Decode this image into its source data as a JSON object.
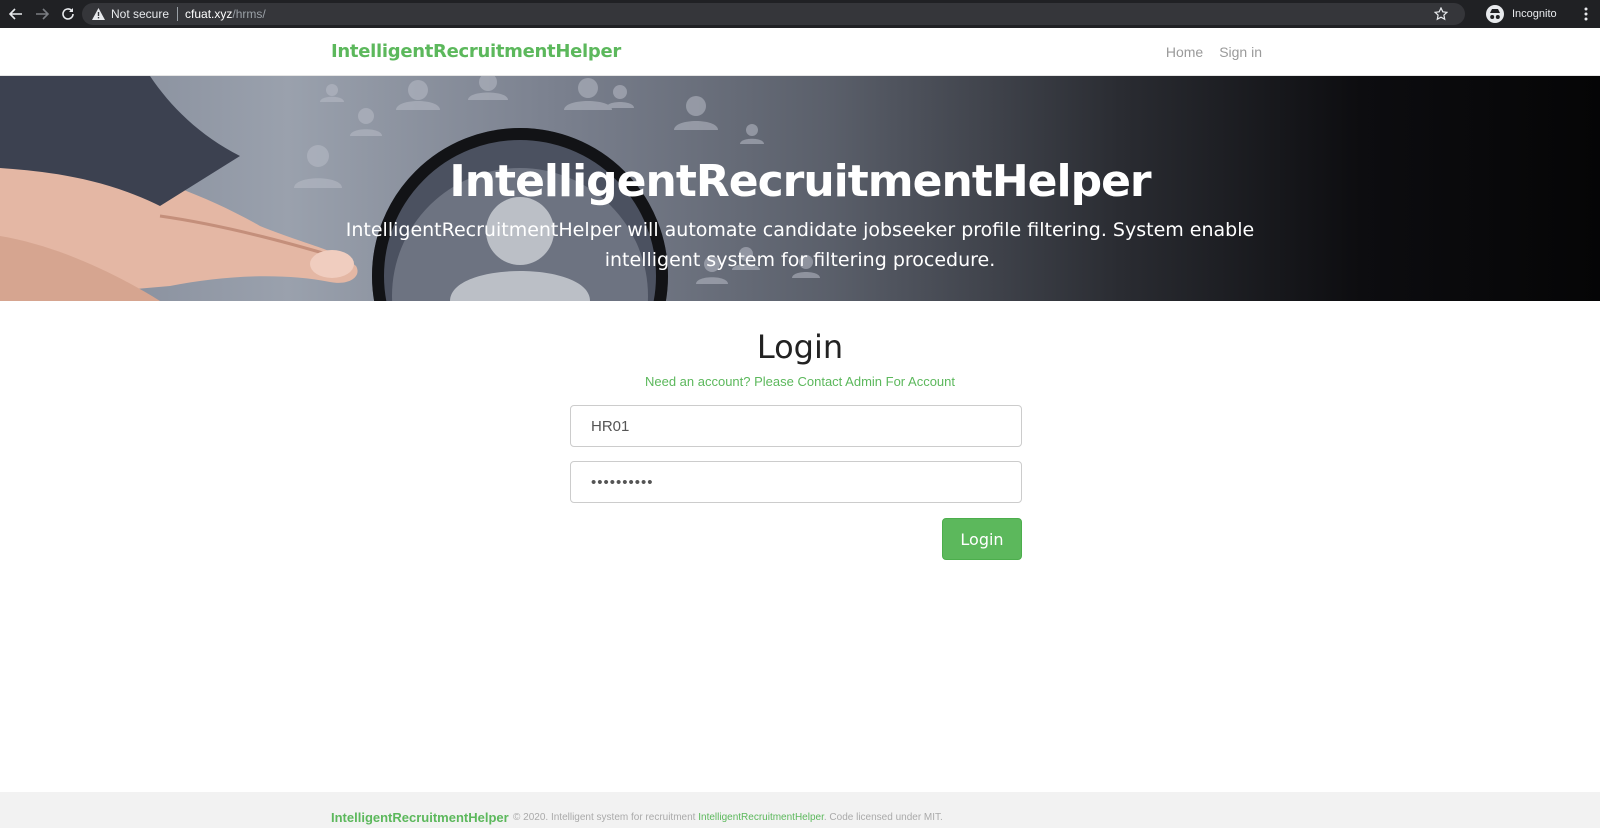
{
  "browser": {
    "security_label": "Not secure",
    "url_host": "cfuat.xyz",
    "url_path": "/hrms/",
    "profile_label": "Incognito"
  },
  "navbar": {
    "brand": "IntelligentRecruitmentHelper",
    "links": [
      "Home",
      "Sign in"
    ]
  },
  "hero": {
    "title": "IntelligentRecruitmentHelper",
    "subtitle": "IntelligentRecruitmentHelper will automate candidate jobseeker profile filtering. System enable intelligent system for filtering procedure."
  },
  "login": {
    "title": "Login",
    "note": "Need an account? Please Contact Admin For Account",
    "username_value": "HR01",
    "password_value": "••••••••••",
    "button_label": "Login"
  },
  "footer": {
    "brand": "IntelligentRecruitmentHelper",
    "text_prefix": "© 2020. Intelligent system for recruitment ",
    "text_link": "IntelligentRecruitmentHelper",
    "text_suffix": ". Code licensed under MIT."
  },
  "colors": {
    "accent": "#5cb85c",
    "browser_chrome": "#202124"
  },
  "icons": [
    "back-arrow-icon",
    "forward-arrow-icon",
    "reload-icon",
    "warning-icon",
    "star-icon",
    "incognito-icon",
    "kebab-menu-icon"
  ]
}
